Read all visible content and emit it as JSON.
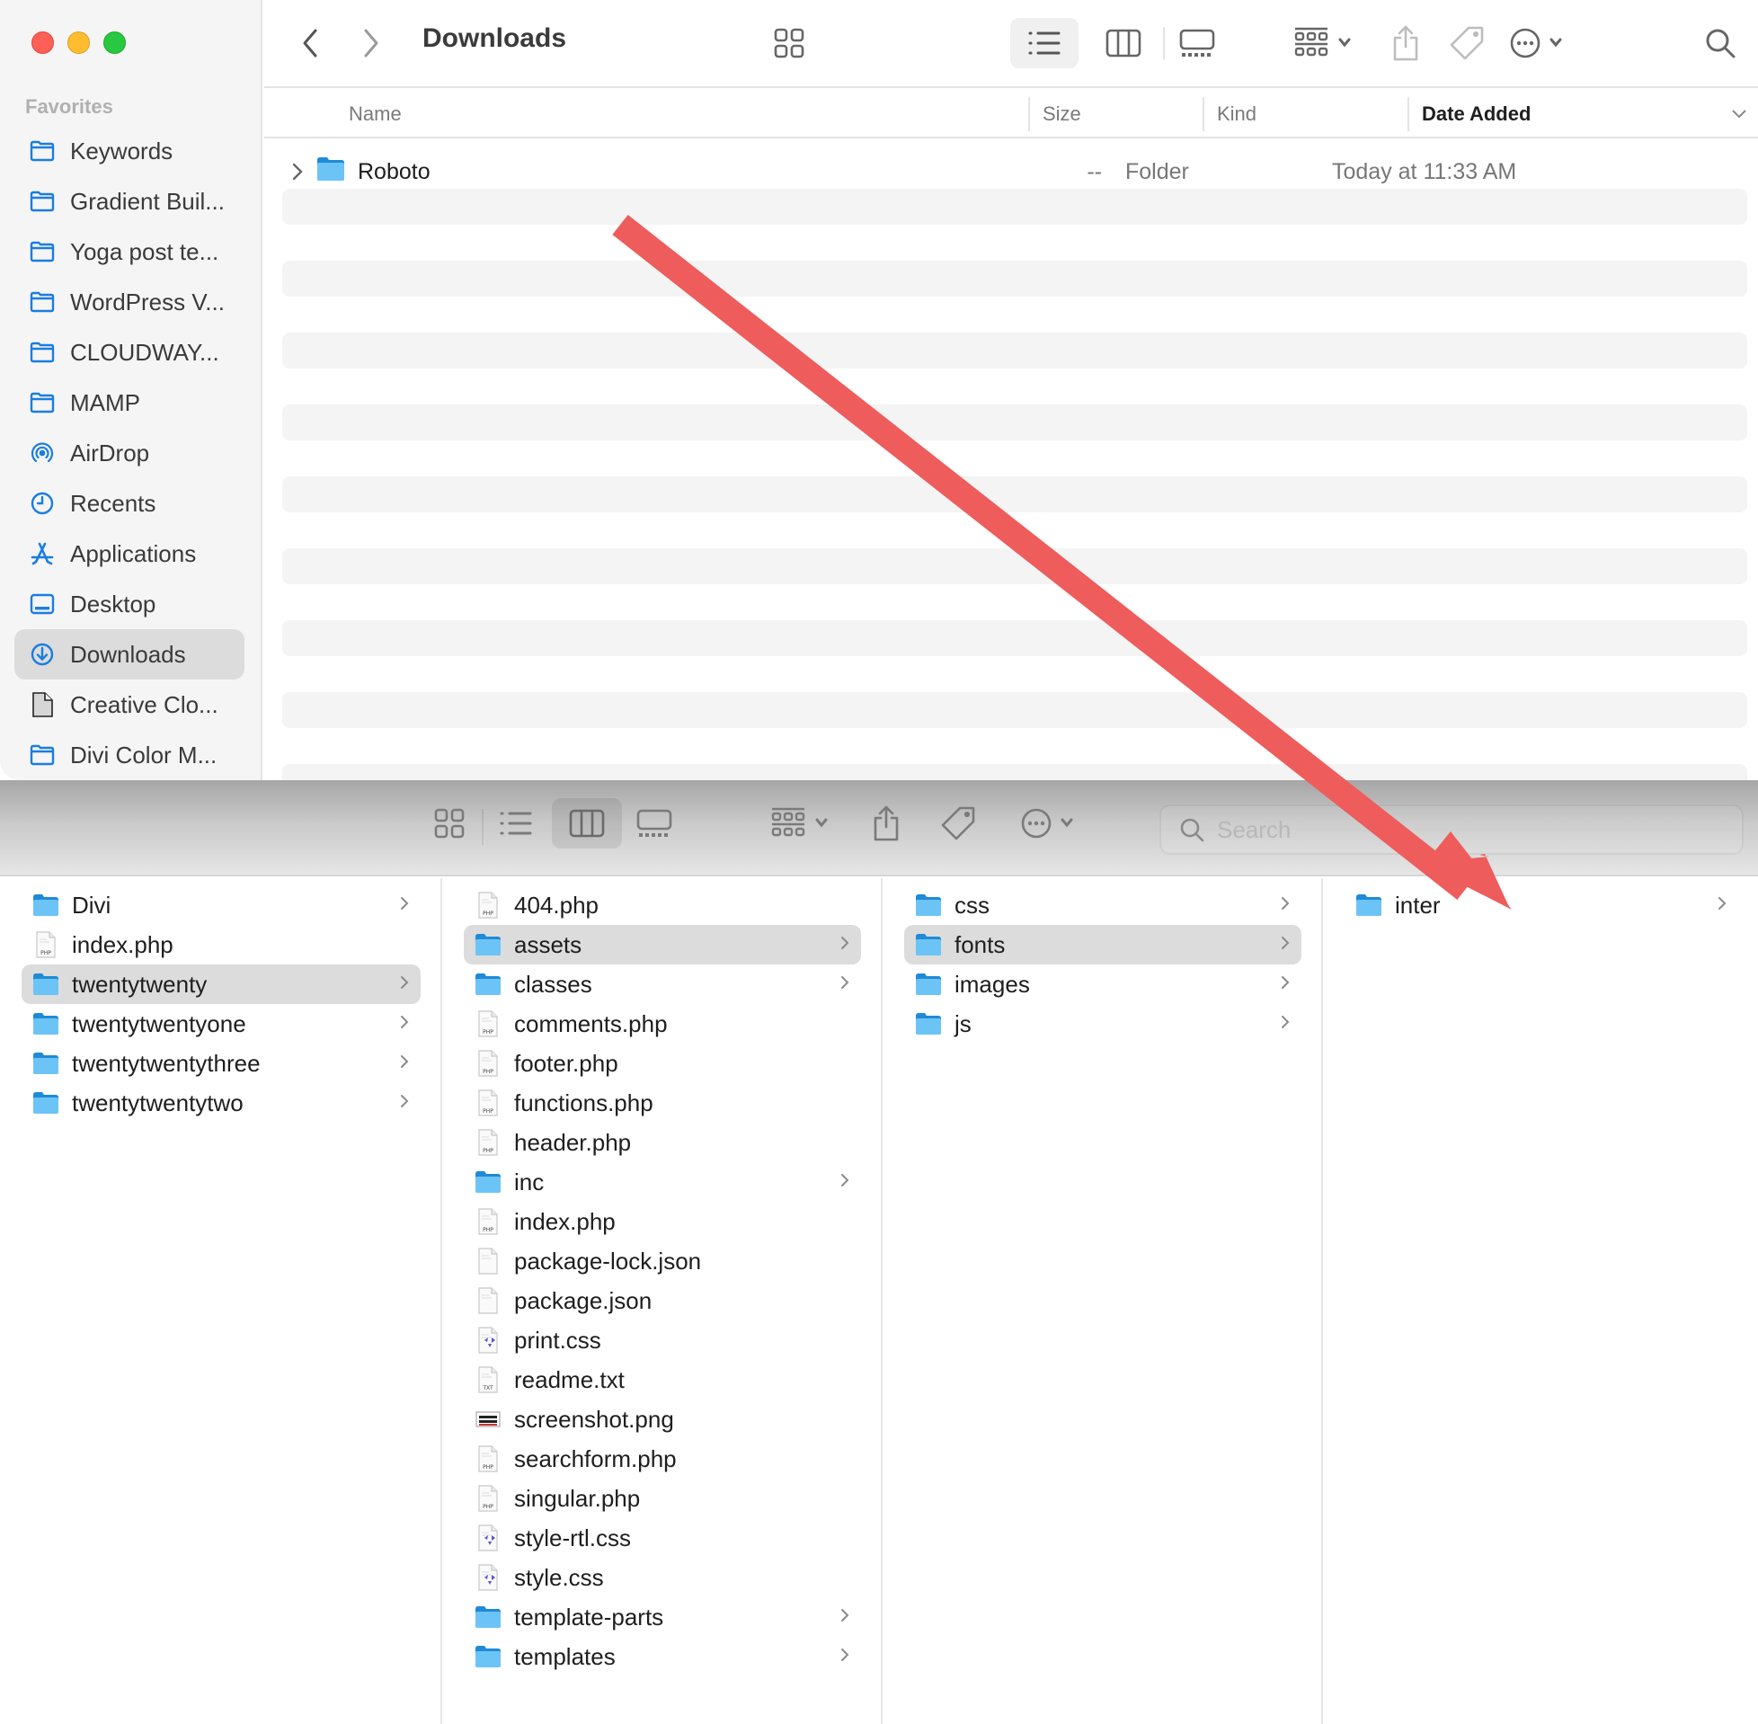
{
  "top_window": {
    "title": "Downloads",
    "sidebar": {
      "heading": "Favorites",
      "items": [
        {
          "label": "Keywords",
          "icon": "folder-icon"
        },
        {
          "label": "Gradient Buil...",
          "icon": "folder-icon"
        },
        {
          "label": "Yoga post te...",
          "icon": "folder-icon"
        },
        {
          "label": "WordPress V...",
          "icon": "folder-icon"
        },
        {
          "label": "CLOUDWAY...",
          "icon": "folder-icon"
        },
        {
          "label": "MAMP",
          "icon": "folder-icon"
        },
        {
          "label": "AirDrop",
          "icon": "airdrop-icon"
        },
        {
          "label": "Recents",
          "icon": "clock-icon"
        },
        {
          "label": "Applications",
          "icon": "applications-icon"
        },
        {
          "label": "Desktop",
          "icon": "desktop-icon"
        },
        {
          "label": "Downloads",
          "icon": "download-icon",
          "selected": true
        },
        {
          "label": "Creative Clo...",
          "icon": "document-icon"
        },
        {
          "label": "Divi Color M...",
          "icon": "folder-icon"
        }
      ]
    },
    "toolbar": {
      "back": "back-icon",
      "forward": "forward-icon",
      "view_modes": [
        "icon-view",
        "list-view",
        "column-view",
        "gallery-view"
      ],
      "active_view": "list-view",
      "group": "group-icon",
      "share": "share-icon",
      "tag": "tag-icon",
      "more": "more-icon",
      "search": "search-icon"
    },
    "list": {
      "columns": [
        "Name",
        "Size",
        "Kind",
        "Date Added"
      ],
      "sorted_column": "Date Added",
      "rows": [
        {
          "name": "Roboto",
          "size": "--",
          "kind": "Folder",
          "date_added": "Today at 11:33 AM",
          "type": "folder",
          "expandable": true
        }
      ]
    }
  },
  "bottom_window": {
    "toolbar": {
      "view_modes": [
        "icon-view",
        "list-view",
        "column-view",
        "gallery-view"
      ],
      "active_view": "column-view",
      "search_placeholder": "Search",
      "search_value": ""
    },
    "columns": [
      {
        "items": [
          {
            "name": "Divi",
            "type": "folder",
            "has_children": true
          },
          {
            "name": "index.php",
            "type": "php",
            "has_children": false
          },
          {
            "name": "twentytwenty",
            "type": "folder",
            "has_children": true,
            "selected": true
          },
          {
            "name": "twentytwentyone",
            "type": "folder",
            "has_children": true
          },
          {
            "name": "twentytwentythree",
            "type": "folder",
            "has_children": true
          },
          {
            "name": "twentytwentytwo",
            "type": "folder",
            "has_children": true
          }
        ]
      },
      {
        "items": [
          {
            "name": "404.php",
            "type": "php",
            "has_children": false
          },
          {
            "name": "assets",
            "type": "folder",
            "has_children": true,
            "selected": true
          },
          {
            "name": "classes",
            "type": "folder",
            "has_children": true
          },
          {
            "name": "comments.php",
            "type": "php",
            "has_children": false
          },
          {
            "name": "footer.php",
            "type": "php",
            "has_children": false
          },
          {
            "name": "functions.php",
            "type": "php",
            "has_children": false
          },
          {
            "name": "header.php",
            "type": "php",
            "has_children": false
          },
          {
            "name": "inc",
            "type": "folder",
            "has_children": true
          },
          {
            "name": "index.php",
            "type": "php",
            "has_children": false
          },
          {
            "name": "package-lock.json",
            "type": "json",
            "has_children": false
          },
          {
            "name": "package.json",
            "type": "json",
            "has_children": false
          },
          {
            "name": "print.css",
            "type": "css",
            "has_children": false
          },
          {
            "name": "readme.txt",
            "type": "txt",
            "has_children": false
          },
          {
            "name": "screenshot.png",
            "type": "png",
            "has_children": false
          },
          {
            "name": "searchform.php",
            "type": "php",
            "has_children": false
          },
          {
            "name": "singular.php",
            "type": "php",
            "has_children": false
          },
          {
            "name": "style-rtl.css",
            "type": "css",
            "has_children": false
          },
          {
            "name": "style.css",
            "type": "css",
            "has_children": false
          },
          {
            "name": "template-parts",
            "type": "folder",
            "has_children": true
          },
          {
            "name": "templates",
            "type": "folder",
            "has_children": true
          }
        ]
      },
      {
        "items": [
          {
            "name": "css",
            "type": "folder",
            "has_children": true
          },
          {
            "name": "fonts",
            "type": "folder",
            "has_children": true,
            "selected": true
          },
          {
            "name": "images",
            "type": "folder",
            "has_children": true
          },
          {
            "name": "js",
            "type": "folder",
            "has_children": true
          }
        ]
      },
      {
        "items": [
          {
            "name": "inter",
            "type": "folder",
            "has_children": true
          }
        ]
      }
    ]
  },
  "annotation": {
    "type": "arrow",
    "color": "#ee5c5c",
    "from": "Roboto folder (top window)",
    "to": "inter folder (bottom window)"
  },
  "colors": {
    "accent": "#1a7de0",
    "folder": "#5ab8f0",
    "traffic_red": "#fe5f57",
    "traffic_yellow": "#febc2e",
    "traffic_green": "#28c840",
    "selection": "#dcdcdc"
  }
}
